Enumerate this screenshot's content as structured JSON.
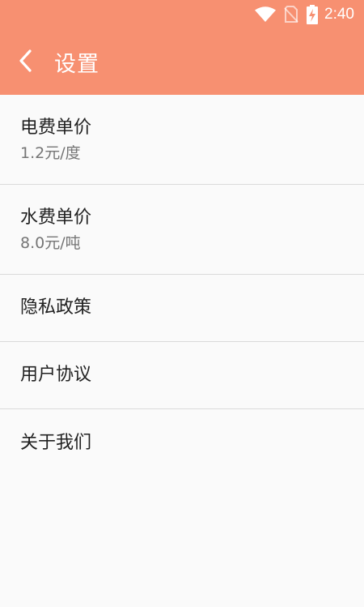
{
  "status_bar": {
    "time": "2:40",
    "icons": [
      "wifi-icon",
      "no-sim-icon",
      "battery-charging-icon"
    ]
  },
  "app_bar": {
    "title": "设置",
    "back_icon": "chevron-left-icon"
  },
  "settings": [
    {
      "label": "电费单价",
      "value": "1.2元/度"
    },
    {
      "label": "水费单价",
      "value": "8.0元/吨"
    },
    {
      "label": "隐私政策"
    },
    {
      "label": "用户协议"
    },
    {
      "label": "关于我们"
    }
  ],
  "colors": {
    "accent": "#f79071",
    "background": "#fafafa",
    "divider": "#dadada",
    "primary_text": "#212121",
    "secondary_text": "#757575"
  }
}
